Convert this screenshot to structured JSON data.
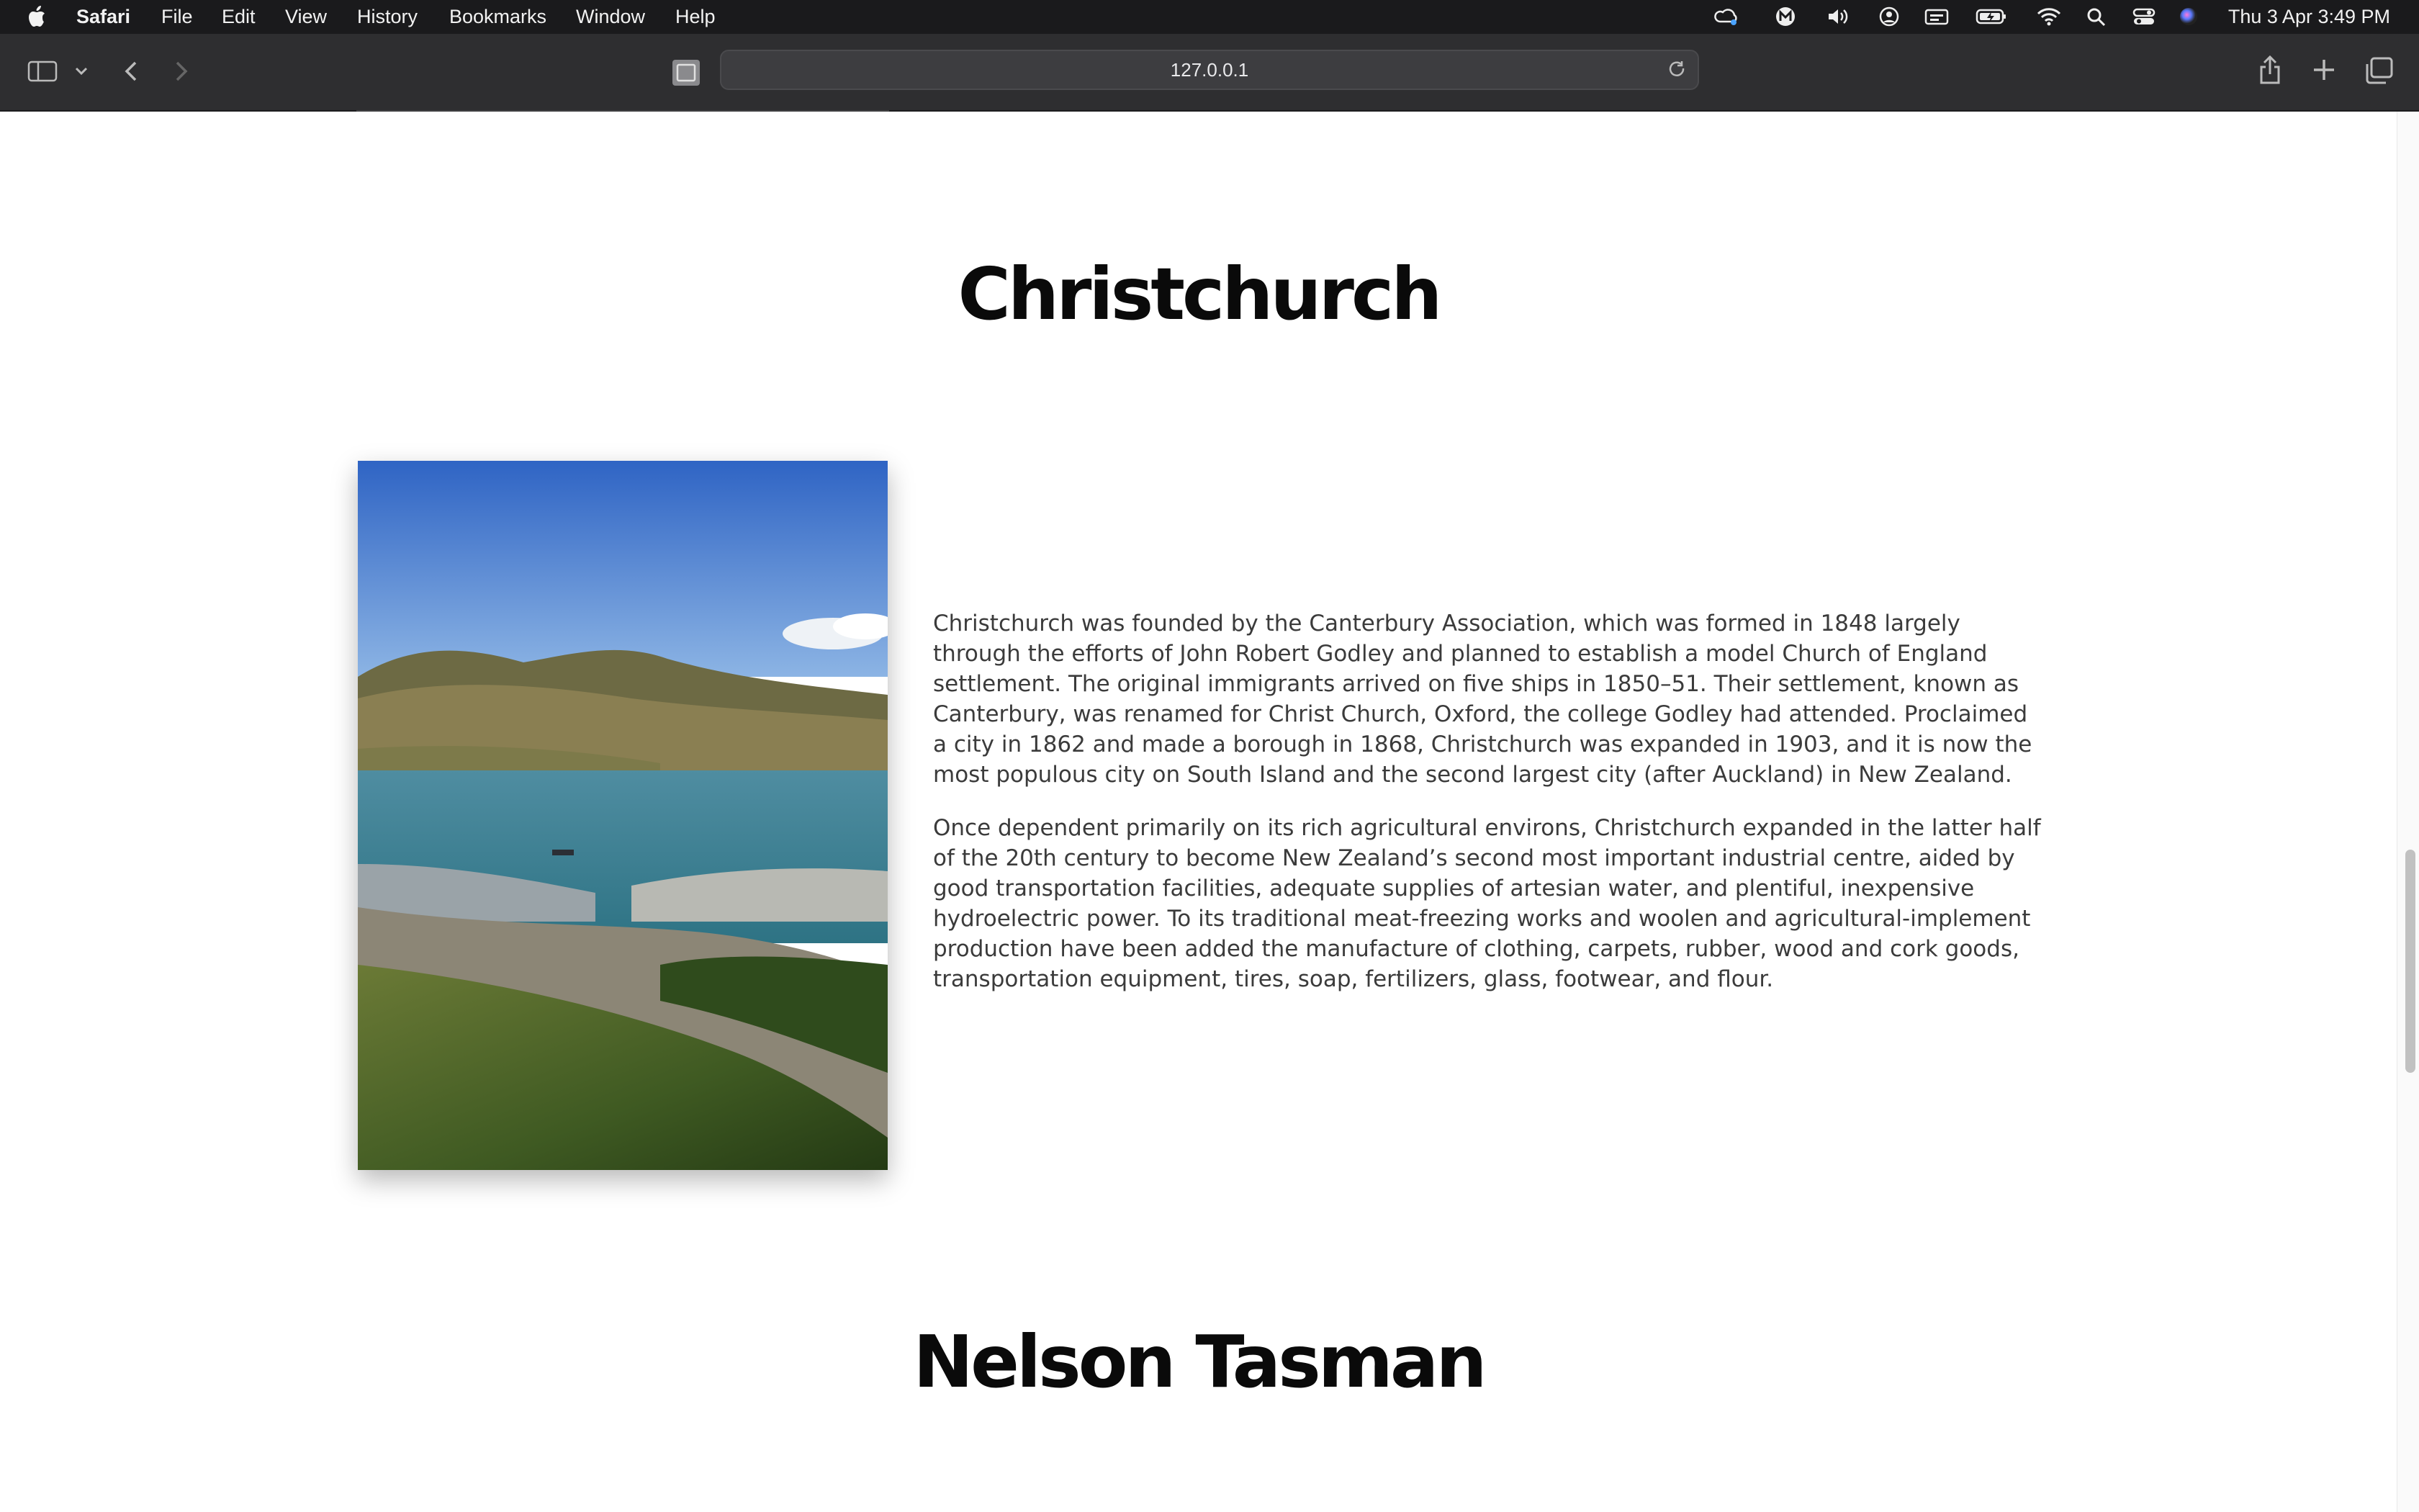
{
  "menubar": {
    "app_name": "Safari",
    "menus": [
      "File",
      "Edit",
      "View",
      "History",
      "Bookmarks",
      "Window",
      "Help"
    ],
    "clock": "Thu 3 Apr  3:49 PM",
    "status_icons": [
      "creative-cloud-icon",
      "m-app-icon",
      "volume-icon",
      "user-icon",
      "keyboard-icon",
      "battery-icon",
      "wifi-icon",
      "spotlight-icon",
      "control-center-icon",
      "siri-icon"
    ]
  },
  "browser": {
    "url": "127.0.0.1"
  },
  "sections": [
    {
      "title": "Christchurch",
      "paragraphs": [
        "Christchurch was founded by the Canterbury Association, which was formed in 1848 largely through the efforts of John Robert Godley and planned to establish a model Church of England settlement. The original immigrants arrived on five ships in 1850–51. Their settlement, known as Canterbury, was renamed for Christ Church, Oxford, the college Godley had attended. Proclaimed a city in 1862 and made a borough in 1868, Christchurch was expanded in 1903, and it is now the most populous city on South Island and the second largest city (after Auckland) in New Zealand.",
        "Once dependent primarily on its rich agricultural environs, Christchurch expanded in the latter half of the 20th century to become New Zealand’s second most important industrial centre, aided by good transportation facilities, adequate supplies of artesian water, and plentiful, inexpensive hydroelectric power. To its traditional meat-freezing works and woolen and agricultural-implement production have been added the manufacture of clothing, carpets, rubber, wood and cork goods, transportation equipment, tires, soap, fertilizers, glass, footwear, and flour."
      ]
    },
    {
      "title": "Nelson Tasman"
    }
  ]
}
